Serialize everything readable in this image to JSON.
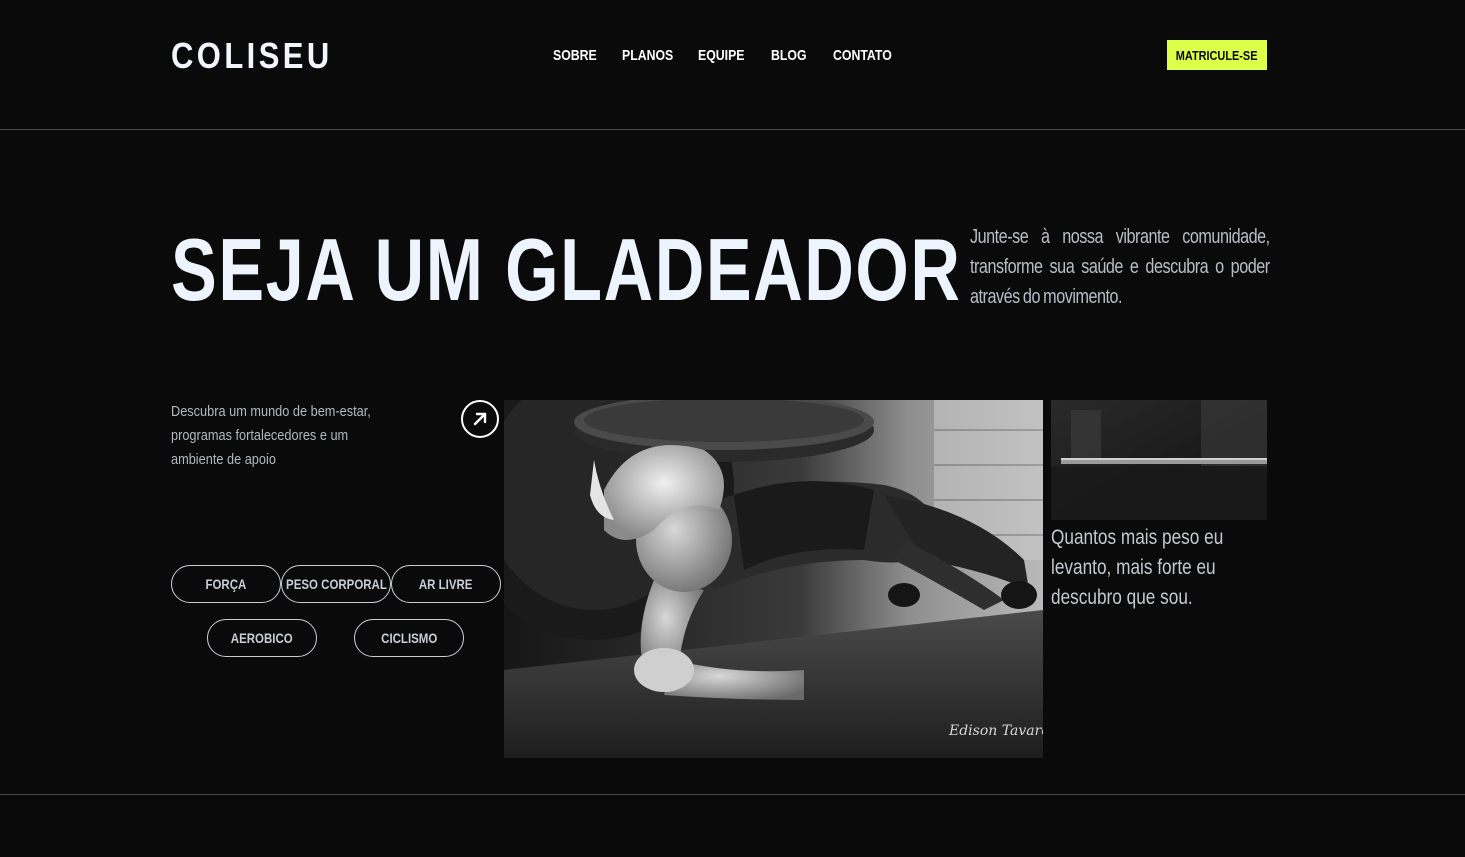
{
  "header": {
    "logo": "COLISEU",
    "nav": [
      {
        "label": "SOBRE"
      },
      {
        "label": "PLANOS"
      },
      {
        "label": "EQUIPE"
      },
      {
        "label": "BLOG"
      },
      {
        "label": "CONTATO"
      }
    ],
    "cta_label": "MATRICULE-SE"
  },
  "hero": {
    "title": "SEJA UM GLADEADOR",
    "lead": "Junte-se à nossa vibrante comunidade, transforme sua saúde e descubra o poder através do movimento.",
    "subtext": "Descubra um mundo de bem-estar, programas fortalecedores e um ambiente de apoio",
    "tags": [
      "FORÇA",
      "PESO CORPORAL",
      "AR LIVRE",
      "AEROBICO",
      "CICLISMO"
    ],
    "quote": "Quantos mais peso eu levanto, mais forte eu descubro que sou."
  },
  "icons": {
    "arrow": "arrow-up-right-icon"
  },
  "colors": {
    "background": "#0a0a0b",
    "accent": "#dcff4a",
    "title": "#eef4fd",
    "muted_text": "#b8bdc6",
    "divider": "#4a4a4f"
  }
}
